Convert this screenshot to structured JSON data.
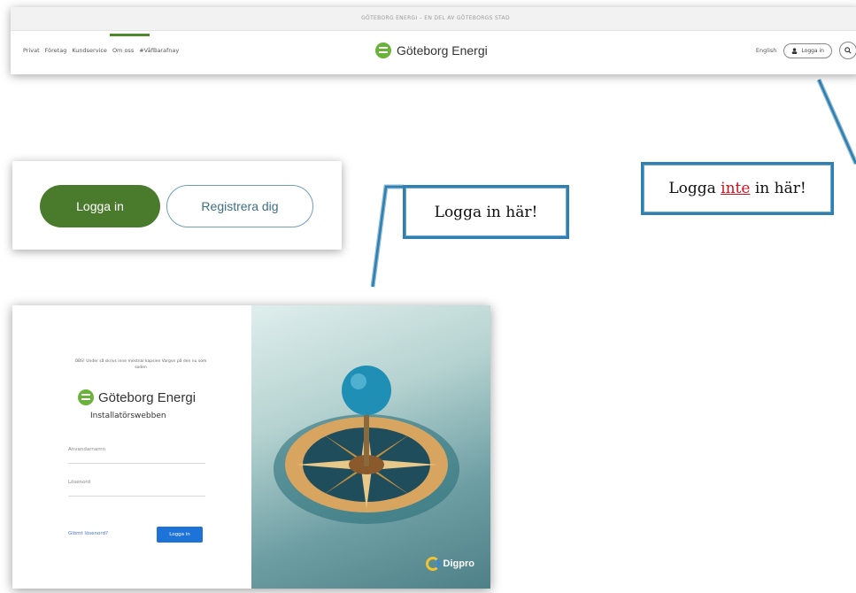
{
  "site_header": {
    "topbar_text": "GÖTEBORG ENERGI – EN DEL AV GÖTEBORGS STAD",
    "nav_links": [
      "Privat",
      "Företag",
      "Kundservice",
      "Om oss",
      "#VåfBarafnay"
    ],
    "brand_name": "Göteborg Energi",
    "language_link": "English",
    "login_label": "Logga in"
  },
  "buttons_crop": {
    "login_label": "Logga in",
    "register_label": "Registrera dig"
  },
  "callouts": {
    "left_text": "Logga in här!",
    "right_prefix": "Logga ",
    "right_emphasis": "inte",
    "right_suffix": " in här!"
  },
  "portal": {
    "intro_text": "OBS! Under så skrivs inne mestnal kapsien Vargvn på den nu som soden",
    "brand_name": "Göteborg Energi",
    "subtitle": "Installatörswebben",
    "username_placeholder": "Anvandarnamn",
    "password_placeholder": "Lösenord",
    "forgot_link": "Glömt lösenord?",
    "login_button": "Logga in",
    "image_brand": "Digpro"
  },
  "colors": {
    "brand_green": "#4a7b2c",
    "callout_border": "#2f7fb0",
    "warning_red": "#d10f1b",
    "portal_button": "#1e73d8"
  }
}
